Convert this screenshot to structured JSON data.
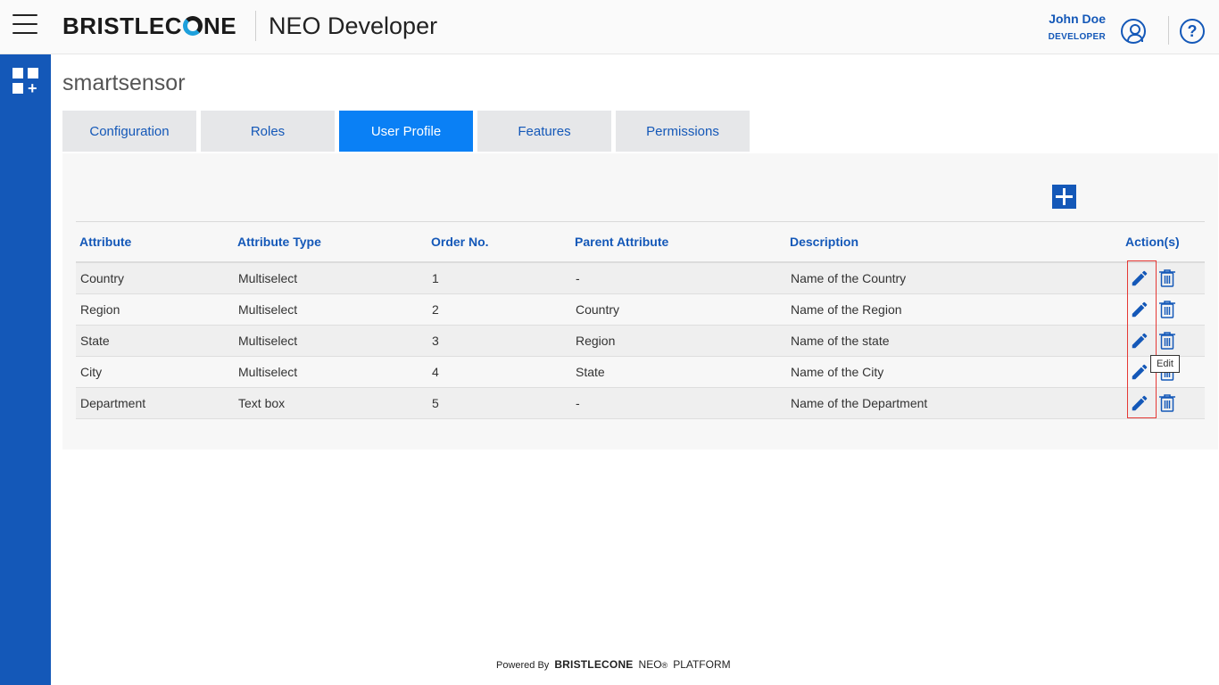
{
  "header": {
    "brand": "BRISTLECONE",
    "app_title": "NEO Developer",
    "user_name": "John Doe",
    "user_role": "DEVELOPER",
    "help_symbol": "?"
  },
  "page": {
    "title": "smartsensor"
  },
  "tabs": [
    {
      "label": "Configuration",
      "active": false
    },
    {
      "label": "Roles",
      "active": false
    },
    {
      "label": "User Profile",
      "active": true
    },
    {
      "label": "Features",
      "active": false
    },
    {
      "label": "Permissions",
      "active": false
    }
  ],
  "table": {
    "columns": [
      "Attribute",
      "Attribute Type",
      "Order No.",
      "Parent Attribute",
      "Description",
      "Action(s)"
    ],
    "rows": [
      [
        "Country",
        "Multiselect",
        "1",
        "-",
        "Name of the Country"
      ],
      [
        "Region",
        "Multiselect",
        "2",
        "Country",
        "Name of the Region"
      ],
      [
        "State",
        "Multiselect",
        "3",
        "Region",
        "Name of the state"
      ],
      [
        "City",
        "Multiselect",
        "4",
        "State",
        "Name of the City"
      ],
      [
        "Department",
        "Text box",
        "5",
        "-",
        "Name of the Department"
      ]
    ]
  },
  "tooltip": "Edit",
  "footer": {
    "powered_by": "Powered By",
    "brand": "BRISTLECONE",
    "neo": "NEO",
    "reg": "®",
    "platform": "PLATFORM"
  },
  "colors": {
    "primary": "#1458b8",
    "active_tab": "#0a80f5",
    "highlight": "#e53935"
  }
}
